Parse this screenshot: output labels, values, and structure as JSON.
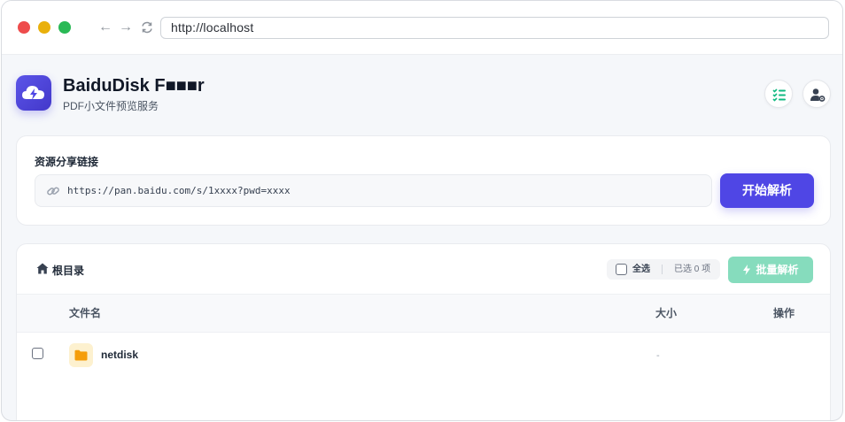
{
  "browser": {
    "url": "http://localhost",
    "back_glyph": "←",
    "forward_glyph": "→"
  },
  "app": {
    "title": "BaiduDisk F■■■r",
    "subtitle": "PDF小文件预览服务",
    "icons": {
      "logo": "cloud-bolt-icon",
      "tasks": "task-list-icon",
      "user": "user-gear-icon"
    }
  },
  "share": {
    "label": "资源分享链接",
    "link_value": "https://pan.baidu.com/s/1xxxx?pwd=xxxx",
    "parse_button": "开始解析"
  },
  "files": {
    "breadcrumb": "根目录",
    "select_all": "全选",
    "selected_count": "已选 0 项",
    "batch_button": "批量解析",
    "columns": {
      "name": "文件名",
      "size": "大小",
      "action": "操作"
    },
    "rows": [
      {
        "name": "netdisk",
        "size": "-",
        "type": "folder"
      }
    ]
  },
  "colors": {
    "accent": "#4f46e5",
    "batch_disabled": "#86dcbd",
    "folder": "#f59e0b",
    "tasks_icon": "#10b981"
  }
}
